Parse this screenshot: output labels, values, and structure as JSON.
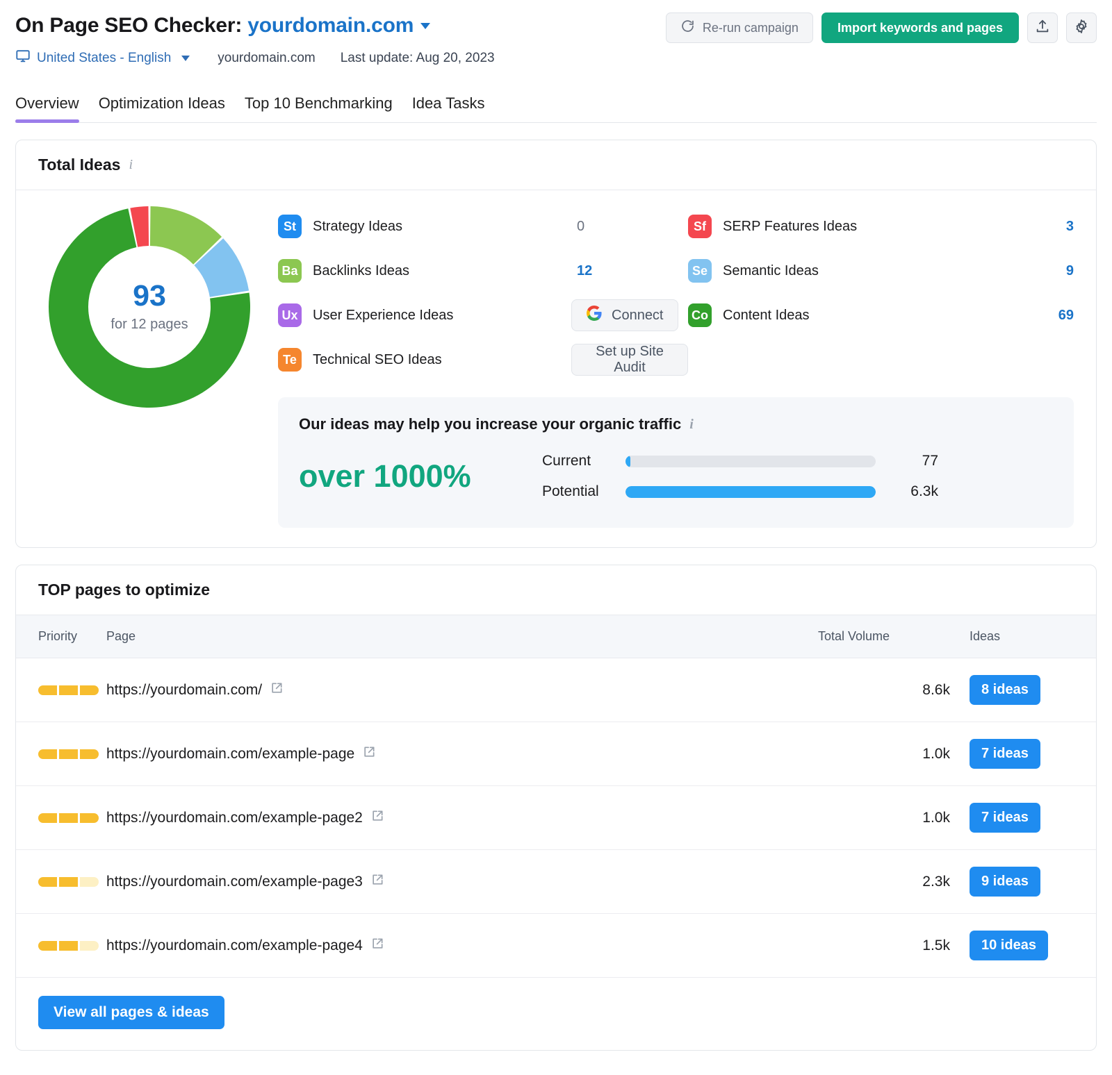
{
  "header": {
    "title_prefix": "On Page SEO Checker:",
    "domain": "yourdomain.com",
    "rerun_label": "Re-run campaign",
    "import_label": "Import keywords and pages",
    "location": "United States - English",
    "sub_domain": "yourdomain.com",
    "last_update": "Last update: Aug 20, 2023"
  },
  "tabs": [
    {
      "label": "Overview",
      "active": true
    },
    {
      "label": "Optimization Ideas",
      "active": false
    },
    {
      "label": "Top 10 Benchmarking",
      "active": false
    },
    {
      "label": "Idea Tasks",
      "active": false
    }
  ],
  "total_ideas": {
    "card_title": "Total Ideas",
    "donut_value": "93",
    "donut_sub": "for 12 pages",
    "left_items": [
      {
        "abbr": "St",
        "label": "Strategy Ideas",
        "value": "0",
        "kind": "zero",
        "color": "#1f8cf0"
      },
      {
        "abbr": "Ba",
        "label": "Backlinks Ideas",
        "value": "12",
        "kind": "num",
        "color": "#8cc751"
      },
      {
        "abbr": "Ux",
        "label": "User Experience Ideas",
        "value": "Connect",
        "kind": "google",
        "color": "#a96ae8"
      },
      {
        "abbr": "Te",
        "label": "Technical SEO Ideas",
        "value": "Set up Site Audit",
        "kind": "button",
        "color": "#f5862e"
      }
    ],
    "right_items": [
      {
        "abbr": "Sf",
        "label": "SERP Features Ideas",
        "value": "3",
        "kind": "num",
        "color": "#f4474f"
      },
      {
        "abbr": "Se",
        "label": "Semantic Ideas",
        "value": "9",
        "kind": "num",
        "color": "#82c3f0"
      },
      {
        "abbr": "Co",
        "label": "Content Ideas",
        "value": "69",
        "kind": "num",
        "color": "#32a02c"
      }
    ],
    "traffic": {
      "title": "Our ideas may help you increase your organic traffic",
      "percent": "over 1000%",
      "current_label": "Current",
      "current_value": "77",
      "current_pct": 2,
      "potential_label": "Potential",
      "potential_value": "6.3k",
      "potential_pct": 100
    }
  },
  "top_pages": {
    "card_title": "TOP pages to optimize",
    "columns": {
      "priority": "Priority",
      "page": "Page",
      "volume": "Total Volume",
      "ideas": "Ideas"
    },
    "rows": [
      {
        "priority": 3,
        "url": "https://yourdomain.com/",
        "volume": "8.6k",
        "ideas": "8 ideas"
      },
      {
        "priority": 3,
        "url": "https://yourdomain.com/example-page",
        "volume": "1.0k",
        "ideas": "7 ideas"
      },
      {
        "priority": 3,
        "url": "https://yourdomain.com/example-page2",
        "volume": "1.0k",
        "ideas": "7 ideas"
      },
      {
        "priority": 2,
        "url": "https://yourdomain.com/example-page3",
        "volume": "2.3k",
        "ideas": "9 ideas"
      },
      {
        "priority": 2,
        "url": "https://yourdomain.com/example-page4",
        "volume": "1.5k",
        "ideas": "10 ideas"
      }
    ],
    "view_all_label": "View all pages & ideas"
  },
  "chart_data": {
    "type": "pie",
    "title": "Total Ideas",
    "center_value": 93,
    "center_label": "for 12 pages",
    "categories": [
      "Content Ideas",
      "Backlinks Ideas",
      "Semantic Ideas",
      "SERP Features Ideas"
    ],
    "values": [
      69,
      12,
      9,
      3
    ],
    "colors": [
      "#32a02c",
      "#8cc751",
      "#82c3f0",
      "#f4474f"
    ],
    "total": 93,
    "legend": "right"
  },
  "colors": {
    "brand_green": "#11a67f",
    "link_blue": "#1a73c8",
    "accent_blue": "#1f8cf0",
    "tab_underline": "#9b7dea",
    "priority_on": "#f7bd2e",
    "priority_off": "#fdf0c4"
  }
}
